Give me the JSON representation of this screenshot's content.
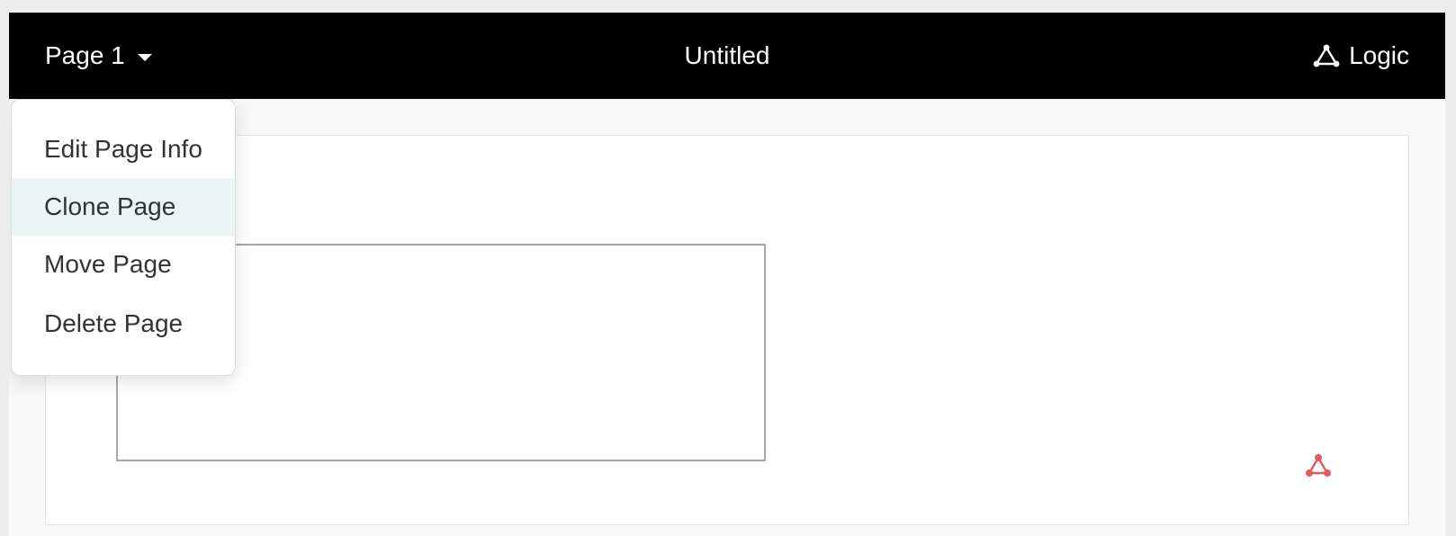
{
  "header": {
    "page_selector_label": "Page 1",
    "title": "Untitled",
    "logic_label": "Logic"
  },
  "page_menu": {
    "items": [
      {
        "label": "Edit Page Info"
      },
      {
        "label": "Clone Page",
        "highlighted": true
      },
      {
        "label": "Move Page"
      },
      {
        "label": "Delete Page"
      }
    ]
  },
  "icons": {
    "page_caret": "chevron-down-icon",
    "logic": "logic-network-icon",
    "logic_marker": "logic-network-icon"
  },
  "colors": {
    "header_background": "#000000",
    "header_text": "#ffffff",
    "menu_highlight": "#e8f5f4",
    "logic_marker": "#e35a5a"
  }
}
